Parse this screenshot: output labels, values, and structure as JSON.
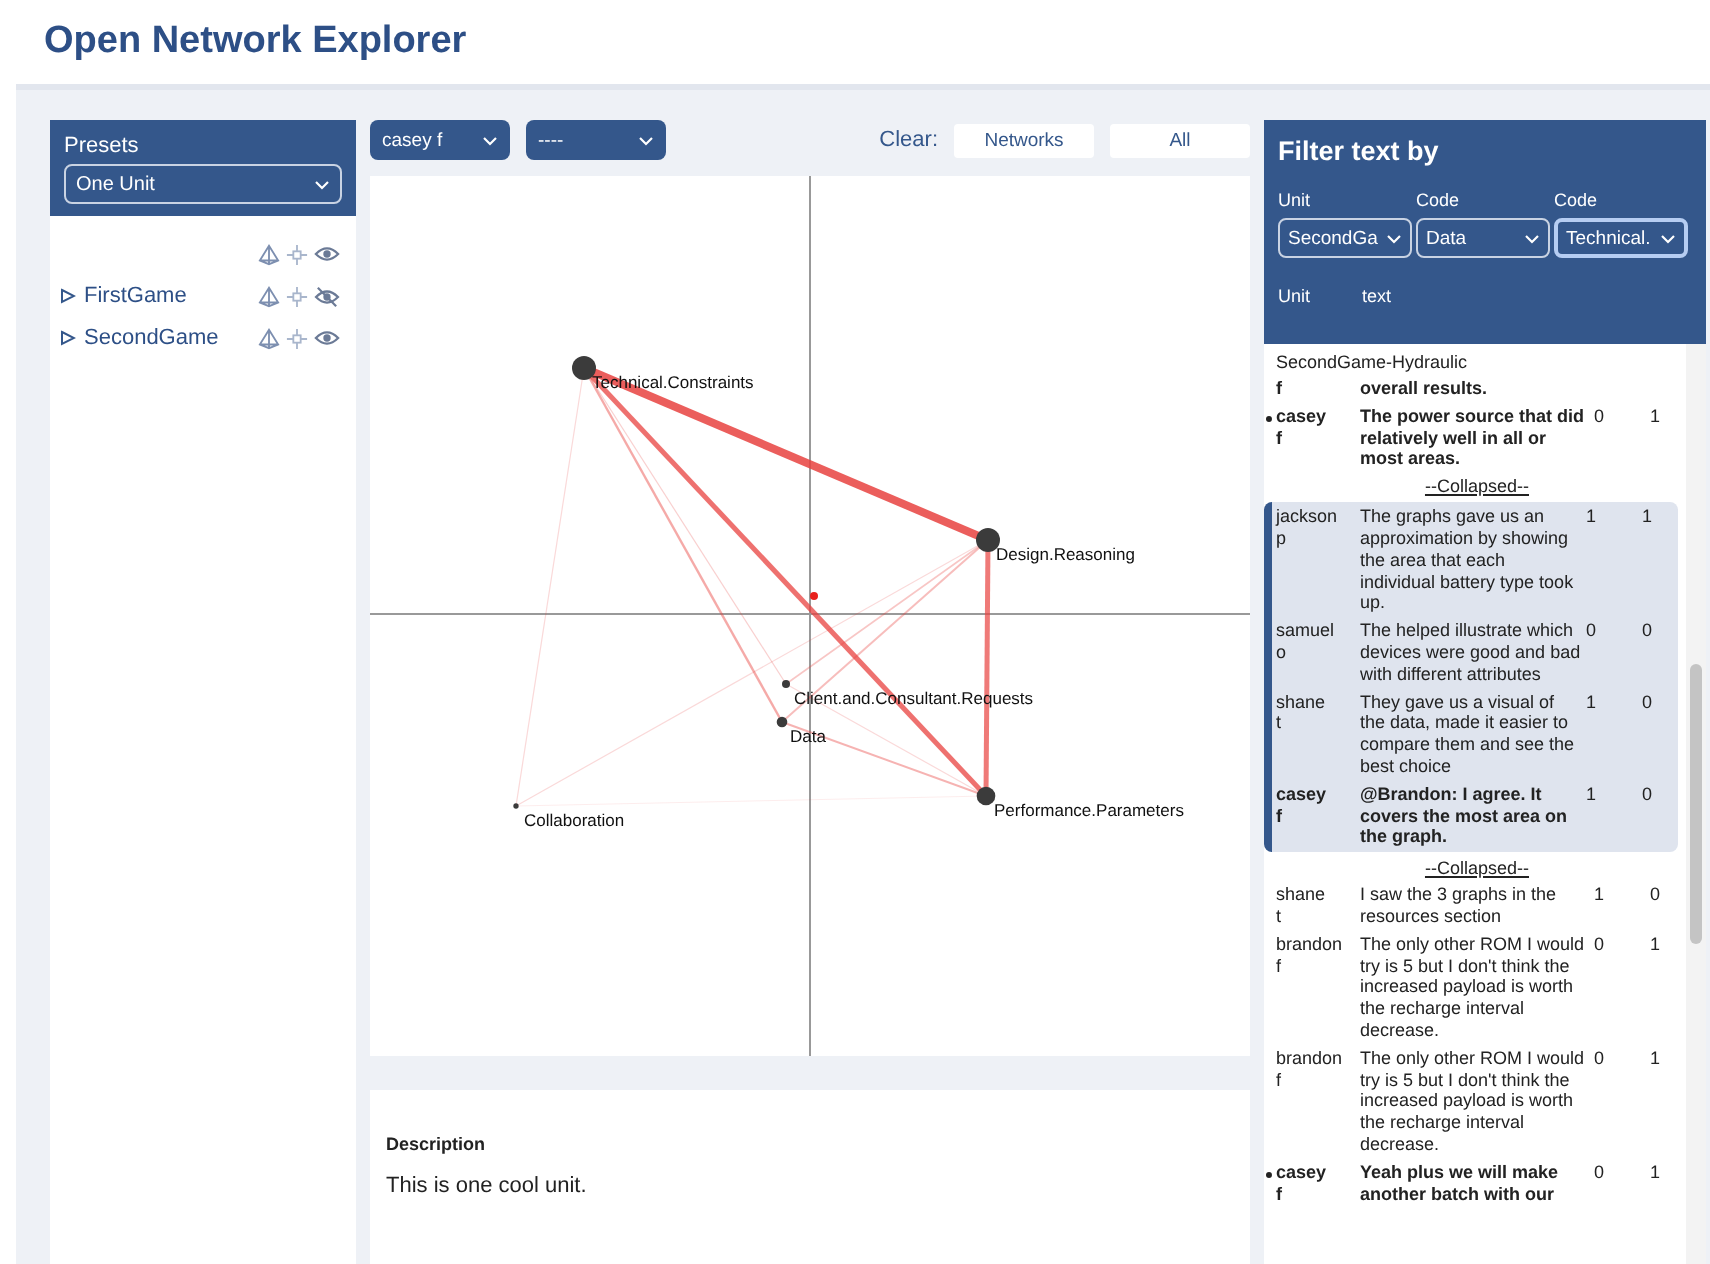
{
  "app_title": "Open Network Explorer",
  "presets": {
    "title": "Presets",
    "select": "One Unit",
    "all_row": {
      "visible": true
    },
    "items": [
      {
        "label": "FirstGame",
        "expanded": false,
        "visible": false
      },
      {
        "label": "SecondGame",
        "expanded": false,
        "visible": true
      }
    ]
  },
  "toolbar": {
    "selects": [
      "casey f",
      "----"
    ],
    "clear_label": "Clear:",
    "buttons": [
      "Networks",
      "All"
    ]
  },
  "network": {
    "nodes": [
      {
        "label": "Technical.Constraints"
      },
      {
        "label": "Design.Reasoning"
      },
      {
        "label": "Performance.Parameters"
      },
      {
        "label": "Client.and.Consultant.Requests"
      },
      {
        "label": "Data"
      },
      {
        "label": "Collaboration"
      }
    ]
  },
  "description": {
    "title": "Description",
    "text": "This is one cool unit."
  },
  "filter": {
    "title": "Filter text by",
    "fields": [
      {
        "label": "Unit",
        "value": "SecondGa",
        "focused": false
      },
      {
        "label": "Code",
        "value": "Data",
        "focused": false
      },
      {
        "label": "Code",
        "value": "Technical.",
        "focused": true
      }
    ],
    "columns": [
      "Unit",
      "text"
    ],
    "items": [
      {
        "kind": "heading",
        "text": "SecondGame-Hydraulic"
      },
      {
        "kind": "message",
        "user": "f",
        "text": "overall results.",
        "marked": false,
        "bold": true
      },
      {
        "kind": "message",
        "user": "casey f",
        "text": "The power source that did relatively well in all or most areas.",
        "column_3": "0",
        "column_4": "1",
        "marked": true,
        "bold": true
      },
      {
        "kind": "toggle",
        "label": "--Collapsed--"
      },
      {
        "kind": "thread",
        "highlighted": true,
        "messages": [
          {
            "user": "jackson p",
            "text": "The graphs gave us an approximation by showing the area that each individual battery type took up.",
            "column_3": "1",
            "column_4": "1",
            "marked": false,
            "bold": false
          },
          {
            "user": "samuel o",
            "text": "The helped illustrate which devices were good and bad with different attributes",
            "column_3": "0",
            "column_4": "0",
            "marked": false,
            "bold": false
          },
          {
            "user": "shane t",
            "text": "They gave us a visual of the data, made it easier to compare them and see the best choice",
            "column_3": "1",
            "column_4": "0",
            "marked": false,
            "bold": false
          },
          {
            "user": "casey f",
            "text": "@Brandon: I agree. It covers the most area on the graph.",
            "column_3": "1",
            "column_4": "0",
            "marked": false,
            "bold": true
          }
        ]
      },
      {
        "kind": "toggle",
        "label": "--Collapsed--"
      },
      {
        "kind": "message",
        "user": "shane t",
        "text": "I saw the 3 graphs in the resources section",
        "column_3": "1",
        "column_4": "0",
        "marked": false,
        "bold": false
      },
      {
        "kind": "message",
        "user": "brandon f",
        "text": "The only other ROM I would try is 5 but I don't think the increased payload is worth the recharge interval decrease.",
        "column_3": "0",
        "column_4": "1",
        "marked": false,
        "bold": false
      },
      {
        "kind": "message",
        "user": "brandon f",
        "text": "The only other ROM I would try is 5 but I don't think the increased payload is worth the recharge interval decrease.",
        "column_3": "0",
        "column_4": "1",
        "marked": false,
        "bold": false
      },
      {
        "kind": "message",
        "user": "casey f",
        "text": "Yeah plus we will make another batch with our",
        "column_3": "0",
        "column_4": "1",
        "marked": true,
        "bold": true
      }
    ]
  }
}
